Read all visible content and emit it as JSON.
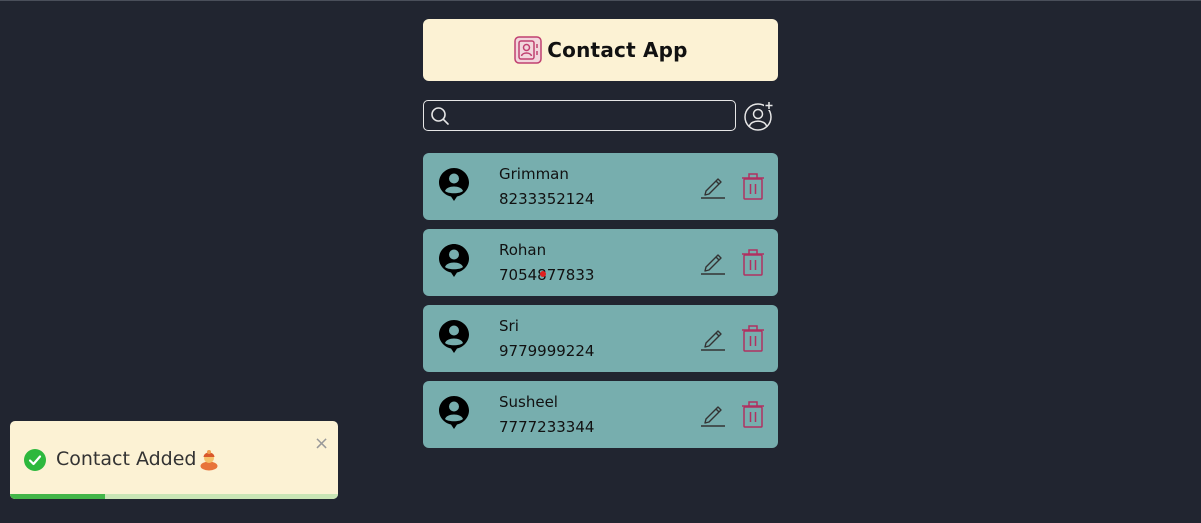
{
  "header": {
    "title": "Contact App",
    "logo_icon": "contact-book-icon",
    "bg_color": "#fcf2d4"
  },
  "search": {
    "value": "",
    "placeholder": "",
    "icon": "search-icon",
    "add_icon": "add-user-icon"
  },
  "contacts": [
    {
      "name": "Grimman",
      "phone": "8233352124"
    },
    {
      "name": "Rohan",
      "phone": "7054877833"
    },
    {
      "name": "Sri",
      "phone": "9779999224"
    },
    {
      "name": "Susheel",
      "phone": "7777233344"
    }
  ],
  "card_color": "#77aeae",
  "delete_color": "#b03060",
  "toast": {
    "message": "Contact Added",
    "close_label": "×",
    "icon": "check-circle-icon",
    "emoji_icon": "person-emoji-icon",
    "progress": 0.29,
    "success_color": "#2db83d"
  }
}
